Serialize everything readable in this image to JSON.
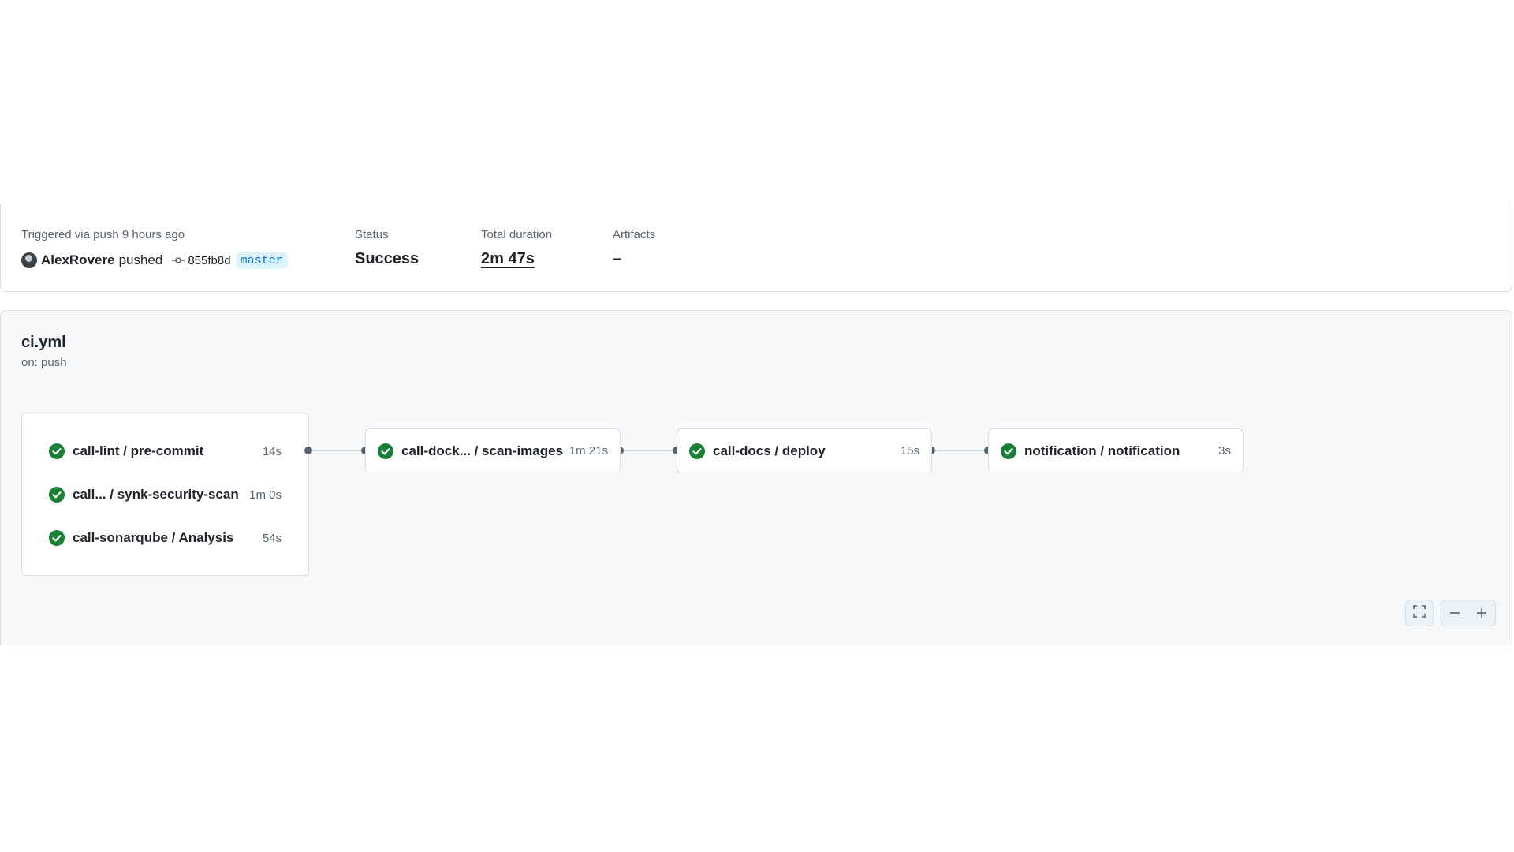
{
  "summary": {
    "trigger_label": "Triggered via push 9 hours ago",
    "actor": "AlexRovere",
    "action": "pushed",
    "commit_sha": "855fb8d",
    "branch": "master",
    "status_label": "Status",
    "status_value": "Success",
    "duration_label": "Total duration",
    "duration_value": "2m 47s",
    "artifacts_label": "Artifacts",
    "artifacts_value": "–"
  },
  "workflow": {
    "name": "ci.yml",
    "trigger": "on: push",
    "stage1": [
      {
        "name": "call-lint / pre-commit",
        "duration": "14s",
        "status": "success"
      },
      {
        "name": "call... / synk-security-scan",
        "duration": "1m 0s",
        "status": "success"
      },
      {
        "name": "call-sonarqube / Analysis",
        "duration": "54s",
        "status": "success"
      }
    ],
    "stage2": {
      "name": "call-dock... / scan-images",
      "duration": "1m 21s",
      "status": "success"
    },
    "stage3": {
      "name": "call-docs / deploy",
      "duration": "15s",
      "status": "success"
    },
    "stage4": {
      "name": "notification / notification",
      "duration": "3s",
      "status": "success"
    }
  },
  "icons": {
    "success": "check-circle-fill-icon",
    "commit": "git-commit-icon",
    "fullscreen": "screen-full-icon",
    "zoom_out": "dash-icon",
    "zoom_in": "plus-icon"
  },
  "colors": {
    "success": "#1a7f37",
    "branch_text": "#0969da",
    "branch_bg": "#ddf4ff"
  }
}
